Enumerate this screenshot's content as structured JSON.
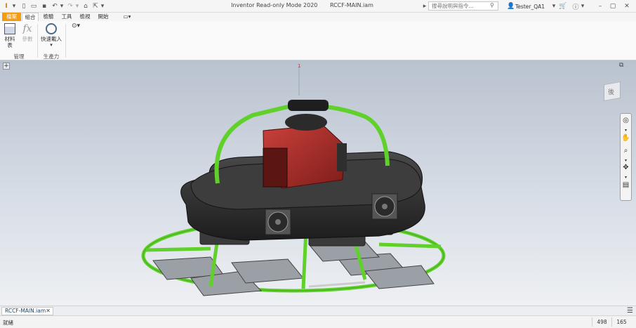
{
  "titlebar": {
    "app_title": "Inventor Read-only Mode 2020",
    "doc_title": "RCCF-MAIN.iam",
    "search_placeholder": "搜尋說明與指令...",
    "user_name": "Tester_QA1"
  },
  "tabs": [
    {
      "label": "檔案"
    },
    {
      "label": "組合"
    },
    {
      "label": "檢驗"
    },
    {
      "label": "工具"
    },
    {
      "label": "檢視"
    },
    {
      "label": "開始"
    }
  ],
  "ribbon": {
    "bom_label": "材料表",
    "params_label": "參數",
    "manage_group": "管理",
    "quick_load_label": "快速載入",
    "productivity_group": "生產力"
  },
  "viewport": {
    "viewcube_face": "後"
  },
  "document_tab": {
    "name": "RCCF-MAIN.iam"
  },
  "statusbar": {
    "status": "就緒",
    "count_a": "498",
    "count_b": "165"
  },
  "colors": {
    "accent_file_tab": "#f39c12",
    "frame_green": "#5fd12a",
    "body_dark": "#2b2b2b",
    "motor_red": "#b8302d"
  }
}
